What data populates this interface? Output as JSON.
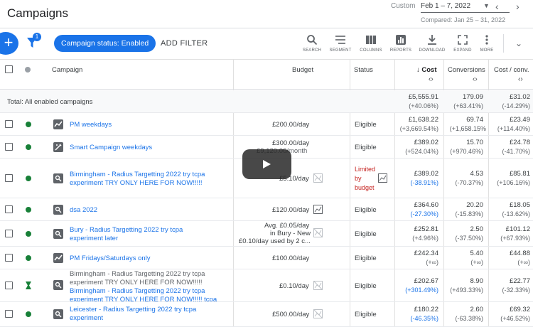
{
  "header": {
    "title": "Campaigns",
    "date_mode": "Custom",
    "date_range": "Feb 1 – 7, 2022",
    "compared": "Compared: Jan 25 – 31, 2022"
  },
  "toolbar": {
    "filter_count": "1",
    "chip": "Campaign status: Enabled",
    "add_filter": "ADD FILTER",
    "tools": [
      "SEARCH",
      "SEGMENT",
      "COLUMNS",
      "REPORTS",
      "DOWNLOAD",
      "EXPAND",
      "MORE"
    ]
  },
  "columns": {
    "campaign": "Campaign",
    "budget": "Budget",
    "status": "Status",
    "cost": "Cost",
    "conversions": "Conversions",
    "cost_conv": "Cost / conv."
  },
  "total": {
    "label": "Total: All enabled campaigns",
    "cost": "£5,555.91",
    "cost_delta": "(+40.06%)",
    "conv": "179.09",
    "conv_delta": "(+63.41%)",
    "cpc": "£31.02",
    "cpc_delta": "(-14.29%)"
  },
  "rows": [
    {
      "name": "PM weekdays",
      "budget": "£200.00/day",
      "status": "Eligible",
      "cost": "£1,638.22",
      "cost_delta": "(+3,669.54%)",
      "conv": "69.74",
      "conv_delta": "(+1,658.15%",
      "cpc": "£23.49",
      "cpc_delta": "(+114.40%)"
    },
    {
      "name": "Smart Campaign weekdays",
      "budget": "£300.00/day",
      "budget2": "£9,120.00/month",
      "status": "Eligible",
      "cost": "£389.02",
      "cost_delta": "(+524.04%)",
      "conv": "15.70",
      "conv_delta": "(+970.46%)",
      "cpc": "£24.78",
      "cpc_delta": "(-41.70%)"
    },
    {
      "name": "Birmingham - Radius Targetting 2022 try tcpa experiment TRY ONLY HERE FOR NOW!!!!!",
      "budget": "£5.10/day",
      "status": [
        "Limited",
        "by",
        "budget"
      ],
      "cost": "£389.02",
      "cost_delta": "(-38.91%)",
      "conv": "4.53",
      "conv_delta": "(-70.37%)",
      "cpc": "£85.81",
      "cpc_delta": "(+106.16%)"
    },
    {
      "name": "dsa 2022",
      "budget": "£120.00/day",
      "status": "Eligible",
      "cost": "£364.60",
      "cost_delta": "(-27.30%)",
      "conv": "20.20",
      "conv_delta": "(-15.83%)",
      "cpc": "£18.05",
      "cpc_delta": "(-13.62%)"
    },
    {
      "name": "Bury - Radius Targetting 2022 try tcpa experiment later",
      "budget": [
        "Avg. £0.05/day",
        "in Bury - New",
        "£0.10/day used by 2 c..."
      ],
      "status": "Eligible",
      "cost": "£252.81",
      "cost_delta": "(+4.96%)",
      "conv": "2.50",
      "conv_delta": "(-37.50%)",
      "cpc": "£101.12",
      "cpc_delta": "(+67.93%)"
    },
    {
      "name": "PM Fridays/Saturdays only",
      "budget": "£100.00/day",
      "status": "Eligible",
      "cost": "£242.34",
      "cost_delta": "(+∞)",
      "conv": "5.40",
      "conv_delta": "(+∞)",
      "cpc": "£44.88",
      "cpc_delta": "(+∞)"
    },
    {
      "name_plain": "Birmingham - Radius Targetting 2022 try tcpa experiment TRY ONLY HERE FOR NOW!!!!!",
      "name": "Birmingham - Radius Targetting 2022 try tcpa experiment TRY ONLY HERE FOR NOW!!!!! tcpa",
      "budget": "£0.10/day",
      "status": "Eligible",
      "cost": "£202.67",
      "cost_delta": "(+301.49%)",
      "conv": "8.90",
      "conv_delta": "(+493.33%)",
      "cpc": "£22.77",
      "cpc_delta": "(-32.33%)"
    },
    {
      "name": "Leicester - Radius Targetting 2022 try tcpa experiment",
      "budget": "£500.00/day",
      "status": "Eligible",
      "cost": "£180.22",
      "cost_delta": "(-46.35%)",
      "conv": "2.60",
      "conv_delta": "(-63.38%)",
      "cpc": "£69.32",
      "cpc_delta": "(+46.52%)"
    }
  ],
  "colors": {
    "accent": "#1a73e8",
    "enabled": "#188038",
    "limited": "#c5221f"
  }
}
